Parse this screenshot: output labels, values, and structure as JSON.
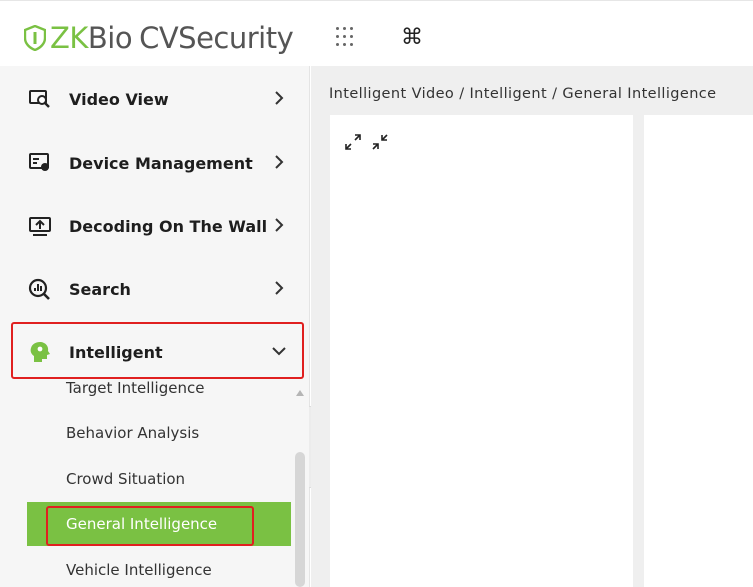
{
  "header": {
    "logo_brand": "ZK",
    "logo_bio": "Bio",
    "logo_product": "CVSecurity",
    "apps_icon": "apps-grid-icon",
    "command_symbol": "⌘"
  },
  "sidebar": {
    "menu": [
      {
        "label": "Video View",
        "icon": "video-search-icon"
      },
      {
        "label": "Device Management",
        "icon": "device-icon"
      },
      {
        "label": "Decoding On The Wall",
        "icon": "monitor-upload-icon"
      },
      {
        "label": "Search",
        "icon": "search-chart-icon"
      },
      {
        "label": "Intelligent",
        "icon": "intelligent-head-icon",
        "expanded": true
      }
    ],
    "submenu": [
      {
        "label": "Target Intelligence"
      },
      {
        "label": "Behavior Analysis"
      },
      {
        "label": "Crowd Situation"
      },
      {
        "label": "General Intelligence",
        "active": true
      },
      {
        "label": "Vehicle Intelligence"
      }
    ],
    "collapse_symbol": "«"
  },
  "main": {
    "breadcrumb": "Intelligent Video / Intelligent / General Intelligence"
  },
  "colors": {
    "accent": "#7ac143",
    "highlight_box": "#e02020",
    "sidebar_bg": "#f6f6f6",
    "main_bg": "#efefef"
  }
}
